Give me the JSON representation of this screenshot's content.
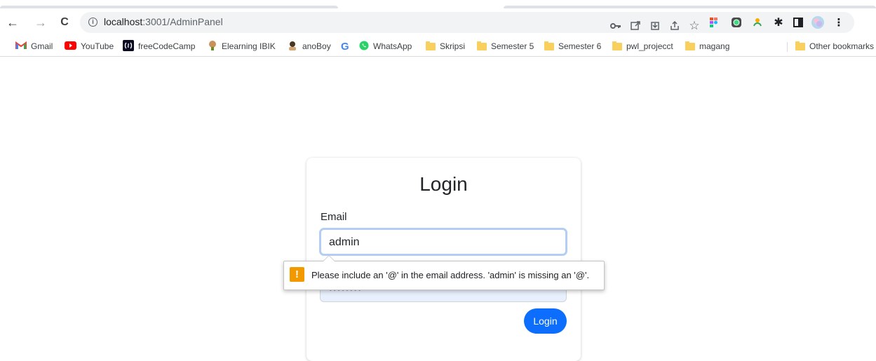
{
  "browser": {
    "url_host": "localhost",
    "url_path": ":3001/AdminPanel",
    "nav": {
      "back": "←",
      "forward": "→",
      "reload": "C"
    },
    "toolbar_icons": [
      "key-icon",
      "external-icon",
      "download-icon",
      "share-icon",
      "star-icon",
      "figma-icon",
      "camera-icon",
      "cast-icon",
      "puzzle-icon",
      "sidebar-icon",
      "profile-avatar",
      "menu-icon"
    ]
  },
  "bookmarks": {
    "items": [
      {
        "label": "Gmail",
        "icon": "gmail-icon"
      },
      {
        "label": "YouTube",
        "icon": "youtube-icon"
      },
      {
        "label": "freeCodeCamp",
        "icon": "freecodecamp-icon"
      },
      {
        "label": "Elearning IBIK",
        "icon": "elearning-icon"
      },
      {
        "label": "anoBoy",
        "icon": "anoboy-icon"
      },
      {
        "label": "",
        "icon": "google-icon"
      },
      {
        "label": "WhatsApp",
        "icon": "whatsapp-icon"
      },
      {
        "label": "Skripsi",
        "icon": "folder-icon"
      },
      {
        "label": "Semester 5",
        "icon": "folder-icon"
      },
      {
        "label": "Semester 6",
        "icon": "folder-icon"
      },
      {
        "label": "pwl_projecct",
        "icon": "folder-icon"
      },
      {
        "label": "magang",
        "icon": "folder-icon"
      }
    ],
    "other": "Other bookmarks"
  },
  "login": {
    "title": "Login",
    "email_label": "Email",
    "email_value": "admin",
    "password_dots": "••••••••",
    "button": "Login"
  },
  "validation": {
    "message": "Please include an '@' in the email address. 'admin' is missing an '@'.",
    "icon": "!"
  },
  "colors": {
    "primary": "#0d6efd",
    "focus_ring": "#b3cdf5",
    "autofill_bg": "#e8f0fe",
    "warning": "#f29900",
    "folder": "#f9cf5d"
  }
}
